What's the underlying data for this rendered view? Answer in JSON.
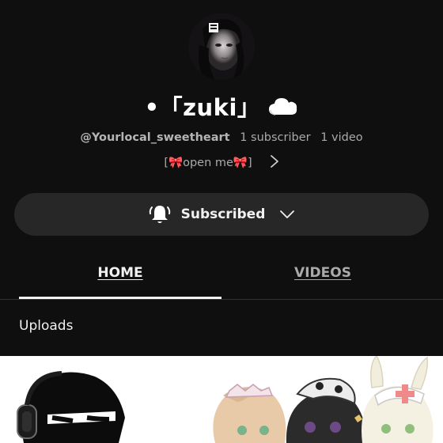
{
  "channel": {
    "name": "•「zuki」",
    "handle": "@Yourlocal_sweetheart",
    "subscribers": "1 subscriber",
    "videos": "1 video",
    "about_text": "[🎀open me🎀]"
  },
  "subscribe_button": {
    "label": "Subscribed"
  },
  "tabs": [
    {
      "label": "HOME",
      "active": true
    },
    {
      "label": "VIDEOS",
      "active": false
    }
  ],
  "section": {
    "title": "Uploads"
  },
  "icons": {
    "avatar": "avatar-image",
    "name_suffix": "cloud-icon",
    "about_more": "chevron-right-icon",
    "bell": "bell-icon",
    "dropdown": "chevron-down-icon"
  },
  "colors": {
    "background": "#0f0f0f",
    "button_background": "#272727",
    "primary_text": "#f1f1f1",
    "secondary_text": "#aaaaaa"
  }
}
